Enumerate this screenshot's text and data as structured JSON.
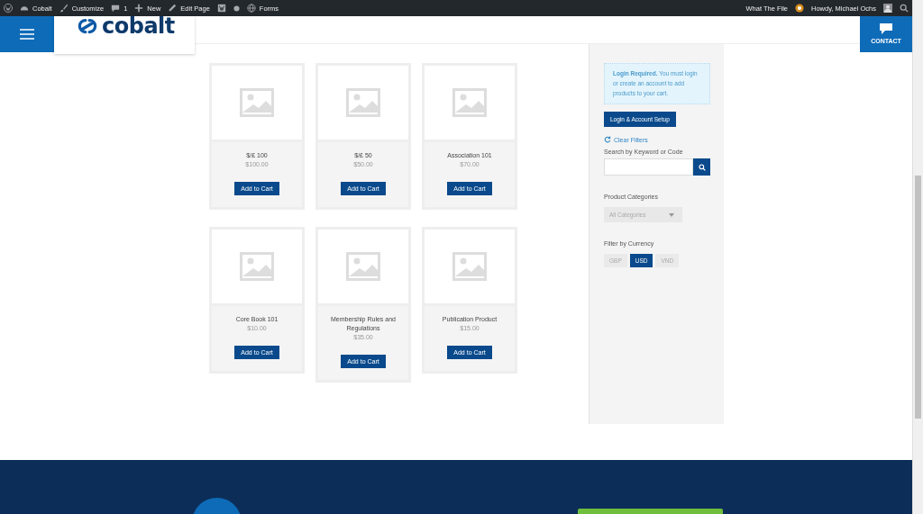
{
  "admin_bar": {
    "site": "Cobalt",
    "customize": "Customize",
    "comments": "1",
    "new": "New",
    "edit": "Edit Page",
    "forms": "Forms",
    "plugin": "What The File",
    "greeting": "Howdy, Michael Ochs"
  },
  "header": {
    "logo": "cobalt",
    "contact": "CONTACT"
  },
  "products": [
    {
      "name": "$/£ 100",
      "price": "$100.00",
      "button": "Add to Cart"
    },
    {
      "name": "$/£ 50",
      "price": "$50.00",
      "button": "Add to Cart"
    },
    {
      "name": "Association 101",
      "price": "$70.00",
      "button": "Add to Cart"
    },
    {
      "name": "Core Book 101",
      "price": "$10.00",
      "button": "Add to Cart"
    },
    {
      "name": "Membership Rules and Regulations",
      "price": "$35.00",
      "button": "Add to Cart"
    },
    {
      "name": "Publication Product",
      "price": "$15.00",
      "button": "Add to Cart"
    }
  ],
  "sidebar": {
    "notice": "**Login Required.** You must login or create an account to add products to your cart.",
    "login_button": "Login & Account Setup",
    "clear_filters": "Clear Filters",
    "search_label": "Search by Keyword or Code",
    "categories_label": "Product Categories",
    "categories_value": "All Categories",
    "currency_label": "Filter by Currency",
    "currencies": [
      {
        "label": "GBP",
        "selected": false
      },
      {
        "label": "USD",
        "selected": true
      },
      {
        "label": "VND",
        "selected": false
      }
    ]
  }
}
